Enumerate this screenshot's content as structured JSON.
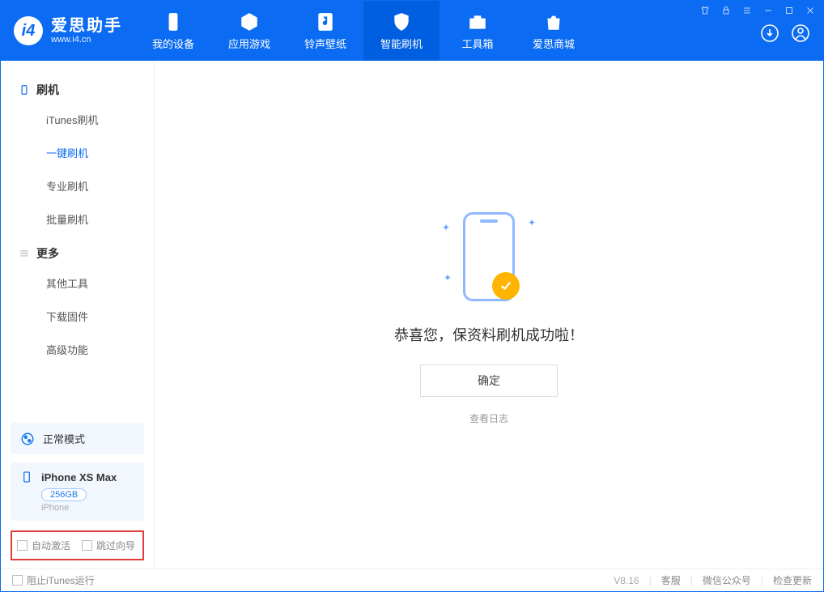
{
  "app": {
    "name_cn": "爱思助手",
    "name_en": "www.i4.cn"
  },
  "nav": {
    "my_device": "我的设备",
    "apps_games": "应用游戏",
    "ring_wall": "铃声壁纸",
    "smart_flash": "智能刷机",
    "toolbox": "工具箱",
    "store": "爱思商城"
  },
  "sidebar": {
    "flash_group": "刷机",
    "items_flash": [
      "iTunes刷机",
      "一键刷机",
      "专业刷机",
      "批量刷机"
    ],
    "more_group": "更多",
    "items_more": [
      "其他工具",
      "下载固件",
      "高级功能"
    ],
    "mode_card": "正常模式",
    "device": {
      "name": "iPhone XS Max",
      "storage": "256GB",
      "type": "iPhone"
    },
    "opt_auto_activate": "自动激活",
    "opt_skip_guide": "跳过向导"
  },
  "main": {
    "success_text": "恭喜您，保资料刷机成功啦！",
    "ok_button": "确定",
    "view_log": "查看日志"
  },
  "status": {
    "block_itunes": "阻止iTunes运行",
    "version": "V8.16",
    "support": "客服",
    "wechat": "微信公众号",
    "check_update": "检查更新"
  }
}
